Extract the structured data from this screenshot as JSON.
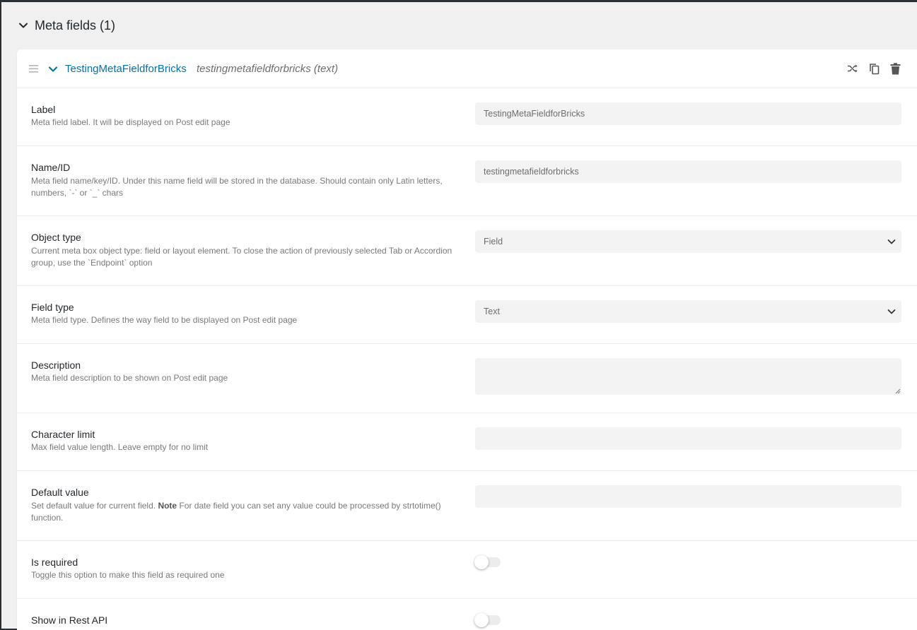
{
  "section": {
    "title": "Meta fields (1)"
  },
  "field": {
    "title": "TestingMetaFieldforBricks",
    "subtitle": "testingmetafieldforbricks (text)"
  },
  "rows": {
    "label": {
      "label": "Label",
      "desc": "Meta field label. It will be displayed on Post edit page",
      "value": "TestingMetaFieldforBricks"
    },
    "name": {
      "label": "Name/ID",
      "desc": "Meta field name/key/ID. Under this name field will be stored in the database. Should contain only Latin letters, numbers, `-` or `_` chars",
      "value": "testingmetafieldforbricks"
    },
    "object_type": {
      "label": "Object type",
      "desc": "Current meta box object type: field or layout element. To close the action of previously selected Tab or Accordion group, use the `Endpoint` option",
      "value": "Field"
    },
    "field_type": {
      "label": "Field type",
      "desc": "Meta field type. Defines the way field to be displayed on Post edit page",
      "value": "Text"
    },
    "description": {
      "label": "Description",
      "desc": "Meta field description to be shown on Post edit page",
      "value": ""
    },
    "char_limit": {
      "label": "Character limit",
      "desc": "Max field value length. Leave empty for no limit",
      "value": ""
    },
    "default_value": {
      "label": "Default value",
      "desc_pre": "Set default value for current field. ",
      "desc_note": "Note",
      "desc_post": " For date field you can set any value could be processed by strtotime() function.",
      "value": ""
    },
    "is_required": {
      "label": "Is required",
      "desc": "Toggle this option to make this field as required one",
      "checked": false
    },
    "show_rest": {
      "label": "Show in Rest API",
      "checked": false
    }
  },
  "colors": {
    "accent": "#0073aa",
    "page_bg": "#f0f0f1",
    "input_bg": "#f3f3f3"
  },
  "icons": {
    "section_toggle": "chevron-down-icon",
    "drag": "drag-handle-icon",
    "collapse": "chevron-down-icon",
    "actions": [
      "shuffle-icon",
      "copy-icon",
      "trash-icon"
    ]
  }
}
